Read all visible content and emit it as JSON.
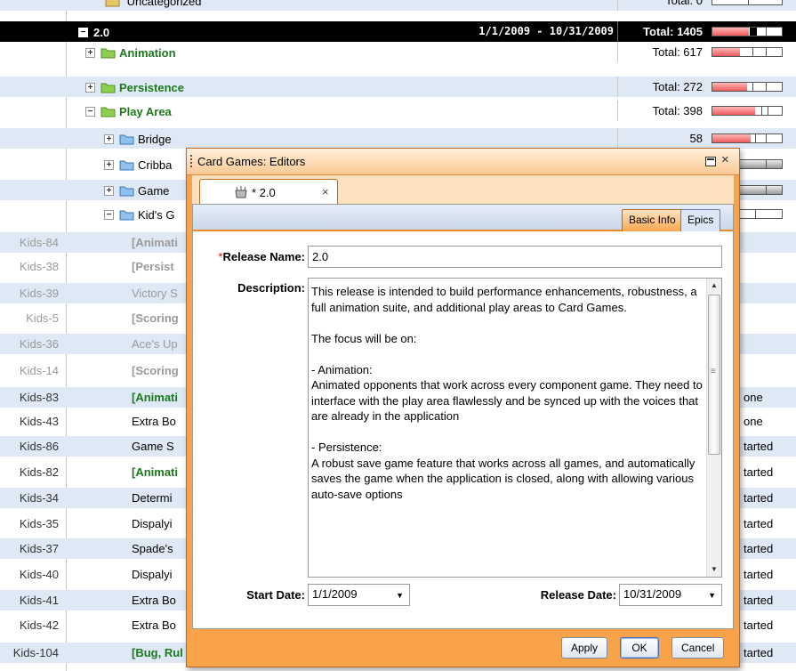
{
  "tree": {
    "uncategorized": {
      "name": "Uncategorized",
      "total": "Total: 0"
    },
    "release": {
      "name": "2.0",
      "dates": "1/1/2009 - 10/31/2009",
      "total": "Total: 1405"
    },
    "groups": [
      {
        "name": "Animation",
        "total": "Total: 617"
      },
      {
        "name": "Persistence",
        "total": "Total: 272"
      },
      {
        "name": "Play Area",
        "total": "Total: 398"
      }
    ],
    "subgroups": [
      {
        "name": "Bridge",
        "total": "58"
      },
      {
        "name": "Cribba",
        "total": ""
      },
      {
        "name": "Game",
        "total": ""
      },
      {
        "name": "Kid's G",
        "total": ""
      }
    ],
    "items": [
      {
        "id": "Kids-84",
        "name": "[Animati",
        "status": ""
      },
      {
        "id": "Kids-38",
        "name": "[Persist",
        "status": ""
      },
      {
        "id": "Kids-39",
        "name": "Victory S",
        "status": ""
      },
      {
        "id": "Kids-5",
        "name": "[Scoring",
        "status": ""
      },
      {
        "id": "Kids-36",
        "name": "Ace's Up",
        "status": ""
      },
      {
        "id": "Kids-14",
        "name": "[Scoring",
        "status": ""
      },
      {
        "id": "Kids-83",
        "name": "[Animati",
        "status": "one"
      },
      {
        "id": "Kids-43",
        "name": "Extra Bo",
        "status": "one"
      },
      {
        "id": "Kids-86",
        "name": "Game S",
        "status": "tarted"
      },
      {
        "id": "Kids-82",
        "name": "[Animati",
        "status": "tarted"
      },
      {
        "id": "Kids-34",
        "name": "Determi",
        "status": "tarted"
      },
      {
        "id": "Kids-35",
        "name": "Dispalyi",
        "status": "tarted"
      },
      {
        "id": "Kids-37",
        "name": "Spade's",
        "status": "tarted"
      },
      {
        "id": "Kids-40",
        "name": "Dispalyi",
        "status": "tarted"
      },
      {
        "id": "Kids-41",
        "name": "Extra Bo",
        "status": "tarted"
      },
      {
        "id": "Kids-42",
        "name": "Extra Bo",
        "status": "tarted"
      },
      {
        "id": "Kids-104",
        "name": "[Bug, Rul",
        "status": "tarted"
      }
    ],
    "progress": {
      "release": 0.52,
      "animation": 0.4,
      "persistence": 0.5,
      "play_area": 0.62,
      "bridge": 0.55
    }
  },
  "dialog": {
    "title": "Card Games: Editors",
    "tab_label": "* 2.0",
    "tab_icon": "backlog-bag-icon",
    "panel_tabs": {
      "basic": "Basic Info",
      "epics": "Epics"
    },
    "release_name_label": "Release Name:",
    "required_marker": "*",
    "release_name_value": "2.0",
    "description_label": "Description:",
    "description_text": "This release is intended to build performance enhancements, robustness, a full animation suite, and additional play areas to Card Games.\n\nThe focus will be on:\n\n- Animation:\nAnimated opponents that work across every component game. They need to interface with the play area flawlessly and be synced up with the voices that are already in the application\n\n- Persistence:\nA robust save game feature that works across all games, and automatically saves the game when the application is closed, along with allowing various auto-save options",
    "start_date_label": "Start Date:",
    "start_date_value": "1/1/2009",
    "release_date_label": "Release Date:",
    "release_date_value": "10/31/2009",
    "buttons": {
      "apply": "Apply",
      "ok": "OK",
      "cancel": "Cancel"
    }
  },
  "colors": {
    "dialog_accent": "#f8a24a",
    "green_text": "#1c7a1c",
    "zebra": "#dfe9f5"
  }
}
